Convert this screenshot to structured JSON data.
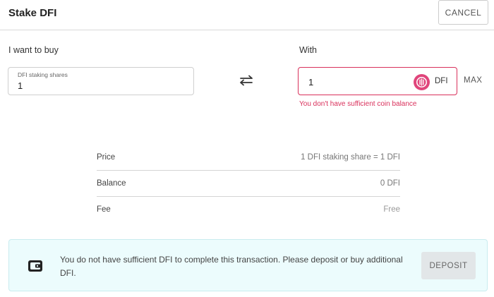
{
  "header": {
    "title": "Stake DFI",
    "cancel_label": "CANCEL"
  },
  "buy": {
    "label": "I want to buy",
    "field_label": "DFI staking shares",
    "value": "1"
  },
  "with": {
    "label": "With",
    "value": "1",
    "coin": "DFI",
    "coin_icon": "dfi-coin-icon",
    "max_label": "MAX",
    "error": "You don't have sufficient coin balance"
  },
  "summary": {
    "rows": [
      {
        "key": "Price",
        "value": "1 DFI staking share = 1 DFI"
      },
      {
        "key": "Balance",
        "value": "0 DFI"
      },
      {
        "key": "Fee",
        "value": "Free"
      }
    ]
  },
  "alert": {
    "message": "You do not have sufficient DFI to complete this transaction. Please deposit or buy additional DFI.",
    "deposit_label": "DEPOSIT",
    "icon": "wallet-icon"
  },
  "colors": {
    "error": "#d9305b",
    "coin": "#e0457b",
    "alert_bg": "#ecfcfd"
  }
}
